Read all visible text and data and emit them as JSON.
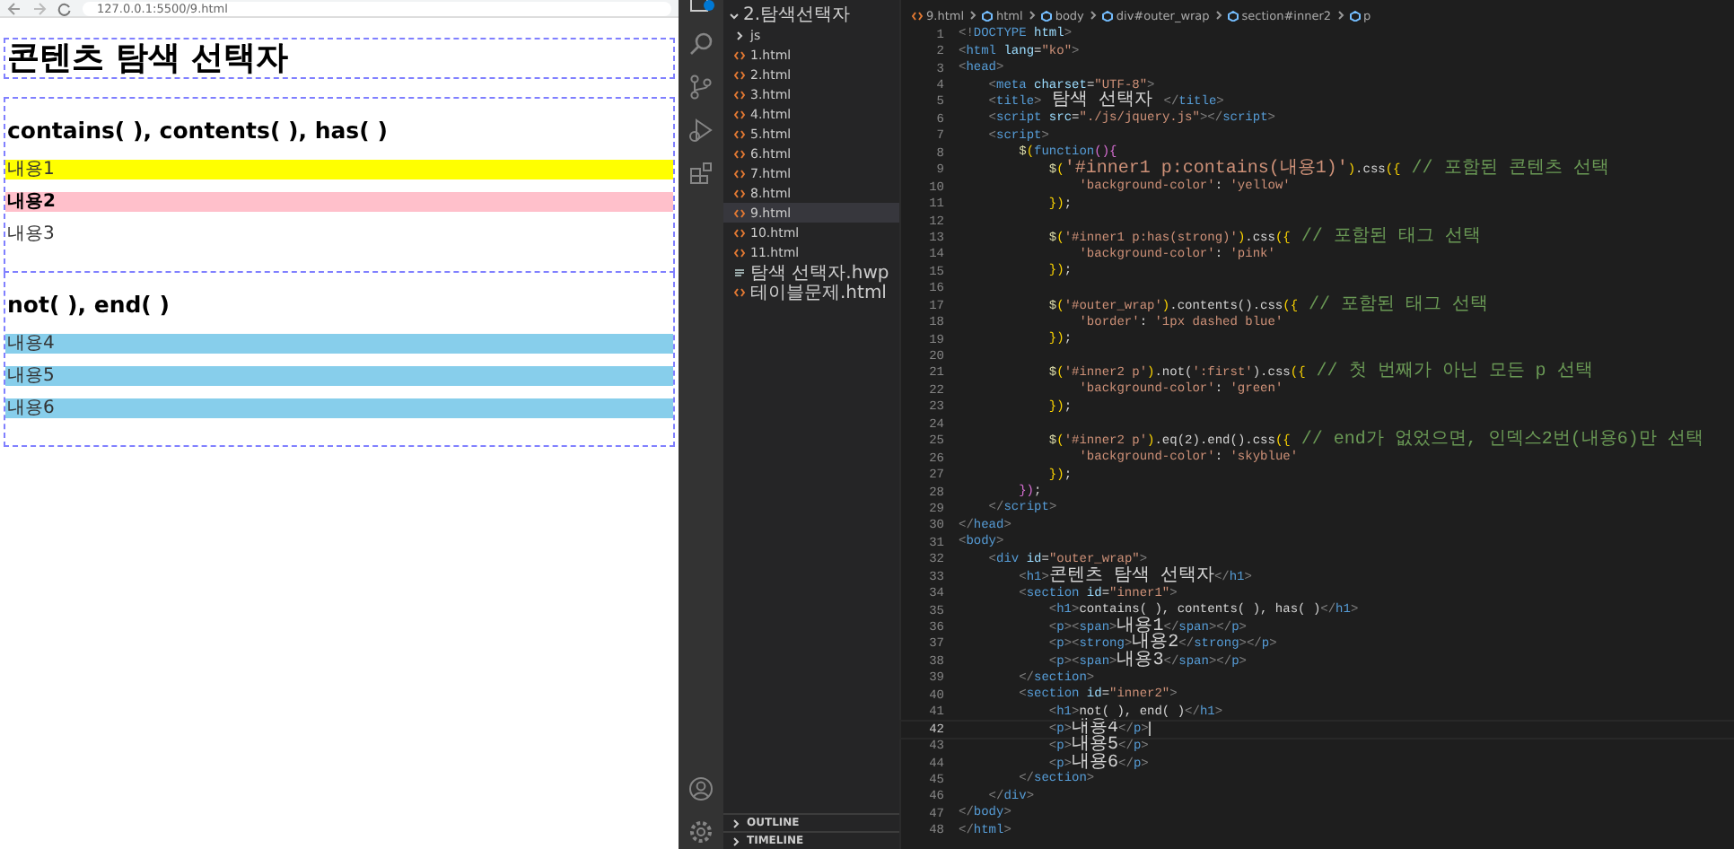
{
  "browser": {
    "url": "127.0.0.1:5500/9.html",
    "page": {
      "title": "콘텐츠 탐색 선택자",
      "sections": [
        {
          "heading": "contains( ), contents( ), has( )",
          "paragraphs": [
            {
              "text": "내용1",
              "color": "#ffff00",
              "bold": false
            },
            {
              "text": "내용2",
              "color": "#ffc0cb",
              "bold": true
            },
            {
              "text": "내용3",
              "bold": false
            }
          ]
        },
        {
          "heading": "not( ), end( )",
          "paragraphs": [
            {
              "text": "내용4",
              "color": "#87ceeb",
              "bold": false
            },
            {
              "text": "내용5",
              "color": "#87ceeb",
              "bold": false
            },
            {
              "text": "내용6",
              "color": "#87ceeb",
              "bold": false
            }
          ]
        }
      ]
    }
  },
  "explorer": {
    "folder": "2.탐색선택자",
    "expanded": true,
    "items": [
      {
        "kind": "folder",
        "name": "js",
        "selected": false
      },
      {
        "kind": "html",
        "name": "1.html",
        "selected": false
      },
      {
        "kind": "html",
        "name": "2.html",
        "selected": false
      },
      {
        "kind": "html",
        "name": "3.html",
        "selected": false
      },
      {
        "kind": "html",
        "name": "4.html",
        "selected": false
      },
      {
        "kind": "html",
        "name": "5.html",
        "selected": false
      },
      {
        "kind": "html",
        "name": "6.html",
        "selected": false
      },
      {
        "kind": "html",
        "name": "7.html",
        "selected": false
      },
      {
        "kind": "html",
        "name": "8.html",
        "selected": false
      },
      {
        "kind": "html",
        "name": "9.html",
        "selected": true
      },
      {
        "kind": "html",
        "name": "10.html",
        "selected": false
      },
      {
        "kind": "html",
        "name": "11.html",
        "selected": false
      },
      {
        "kind": "doc",
        "name": "탐색 선택자.hwp",
        "selected": false
      },
      {
        "kind": "html",
        "name": "테이블문제.html",
        "selected": false
      }
    ],
    "panels": [
      "OUTLINE",
      "TIMELINE"
    ]
  },
  "editor": {
    "breadcrumb": [
      "9.html",
      "html",
      "body",
      "div#outer_wrap",
      "section#inner2",
      "p"
    ],
    "lines": [
      {
        "num": "1",
        "current": false,
        "tokens": [
          {
            "kind": "punct",
            "text": "<!"
          },
          {
            "kind": "tag",
            "text": "DOCTYPE"
          },
          {
            "kind": "attr",
            "text": " html"
          },
          {
            "kind": "punct",
            "text": ">"
          }
        ]
      },
      {
        "num": "2",
        "current": false,
        "tokens": [
          {
            "kind": "punct",
            "text": "<"
          },
          {
            "kind": "tag",
            "text": "html"
          },
          {
            "kind": "attr",
            "text": " lang"
          },
          {
            "kind": "text",
            "text": "="
          },
          {
            "kind": "str",
            "text": "\"ko\""
          },
          {
            "kind": "punct",
            "text": ">"
          }
        ]
      },
      {
        "num": "3",
        "current": false,
        "tokens": [
          {
            "kind": "punct",
            "text": "<"
          },
          {
            "kind": "tag",
            "text": "head"
          },
          {
            "kind": "punct",
            "text": ">"
          }
        ]
      },
      {
        "num": "4",
        "current": false,
        "tokens": [
          {
            "kind": "punct",
            "text": "    <"
          },
          {
            "kind": "tag",
            "text": "meta"
          },
          {
            "kind": "attr",
            "text": " charset"
          },
          {
            "kind": "text",
            "text": "="
          },
          {
            "kind": "str",
            "text": "\"UTF-8\""
          },
          {
            "kind": "punct",
            "text": ">"
          }
        ]
      },
      {
        "num": "5",
        "current": false,
        "tokens": [
          {
            "kind": "punct",
            "text": "    <"
          },
          {
            "kind": "tag",
            "text": "title"
          },
          {
            "kind": "punct",
            "text": ">"
          },
          {
            "kind": "text",
            "text": " 탐색 선택자 "
          },
          {
            "kind": "punct",
            "text": "</"
          },
          {
            "kind": "tag",
            "text": "title"
          },
          {
            "kind": "punct",
            "text": ">"
          }
        ]
      },
      {
        "num": "6",
        "current": false,
        "tokens": [
          {
            "kind": "punct",
            "text": "    <"
          },
          {
            "kind": "tag",
            "text": "script"
          },
          {
            "kind": "attr",
            "text": " src"
          },
          {
            "kind": "text",
            "text": "="
          },
          {
            "kind": "str",
            "text": "\"./js/jquery.js\""
          },
          {
            "kind": "punct",
            "text": "></"
          },
          {
            "kind": "tag",
            "text": "script"
          },
          {
            "kind": "punct",
            "text": ">"
          }
        ]
      },
      {
        "num": "7",
        "current": false,
        "tokens": [
          {
            "kind": "punct",
            "text": "    <"
          },
          {
            "kind": "tag",
            "text": "script"
          },
          {
            "kind": "punct",
            "text": ">"
          }
        ]
      },
      {
        "num": "8",
        "current": false,
        "tokens": [
          {
            "kind": "fn",
            "text": "        $"
          },
          {
            "kind": "brace",
            "text": "("
          },
          {
            "kind": "tag",
            "text": "function"
          },
          {
            "kind": "brace2",
            "text": "(){"
          }
        ]
      },
      {
        "num": "9",
        "current": false,
        "tokens": [
          {
            "kind": "fn",
            "text": "            $"
          },
          {
            "kind": "brace",
            "text": "("
          },
          {
            "kind": "str",
            "text": "'#inner1 p:contains(내용1)'"
          },
          {
            "kind": "brace",
            "text": ")"
          },
          {
            "kind": "text",
            "text": ".css"
          },
          {
            "kind": "brace",
            "text": "({"
          },
          {
            "kind": "comment",
            "text": " // 포함된 콘텐츠 선택"
          }
        ]
      },
      {
        "num": "10",
        "current": false,
        "tokens": [
          {
            "kind": "str",
            "text": "                'background-color'"
          },
          {
            "kind": "text",
            "text": ": "
          },
          {
            "kind": "str",
            "text": "'yellow'"
          }
        ]
      },
      {
        "num": "11",
        "current": false,
        "tokens": [
          {
            "kind": "brace",
            "text": "            })"
          },
          {
            "kind": "text",
            "text": ";"
          }
        ]
      },
      {
        "num": "12",
        "current": false
      },
      {
        "num": "13",
        "current": false,
        "tokens": [
          {
            "kind": "fn",
            "text": "            $"
          },
          {
            "kind": "brace",
            "text": "("
          },
          {
            "kind": "str",
            "text": "'#inner1 p:has(strong)'"
          },
          {
            "kind": "brace",
            "text": ")"
          },
          {
            "kind": "text",
            "text": ".css"
          },
          {
            "kind": "brace",
            "text": "({"
          },
          {
            "kind": "comment",
            "text": " // 포함된 태그 선택"
          }
        ]
      },
      {
        "num": "14",
        "current": false,
        "tokens": [
          {
            "kind": "str",
            "text": "                'background-color'"
          },
          {
            "kind": "text",
            "text": ": "
          },
          {
            "kind": "str",
            "text": "'pink'"
          }
        ]
      },
      {
        "num": "15",
        "current": false,
        "tokens": [
          {
            "kind": "brace",
            "text": "            })"
          },
          {
            "kind": "text",
            "text": ";"
          }
        ]
      },
      {
        "num": "16",
        "current": false
      },
      {
        "num": "17",
        "current": false,
        "tokens": [
          {
            "kind": "fn",
            "text": "            $"
          },
          {
            "kind": "brace",
            "text": "("
          },
          {
            "kind": "str",
            "text": "'#outer_wrap'"
          },
          {
            "kind": "brace",
            "text": ")"
          },
          {
            "kind": "text",
            "text": ".contents().css"
          },
          {
            "kind": "brace",
            "text": "({"
          },
          {
            "kind": "comment",
            "text": " // 포함된 태그 선택"
          }
        ]
      },
      {
        "num": "18",
        "current": false,
        "tokens": [
          {
            "kind": "str",
            "text": "                'border'"
          },
          {
            "kind": "text",
            "text": ": "
          },
          {
            "kind": "str",
            "text": "'1px dashed blue'"
          }
        ]
      },
      {
        "num": "19",
        "current": false,
        "tokens": [
          {
            "kind": "brace",
            "text": "            })"
          },
          {
            "kind": "text",
            "text": ";"
          }
        ]
      },
      {
        "num": "20",
        "current": false
      },
      {
        "num": "21",
        "current": false,
        "tokens": [
          {
            "kind": "fn",
            "text": "            $"
          },
          {
            "kind": "brace",
            "text": "("
          },
          {
            "kind": "str",
            "text": "'#inner2 p'"
          },
          {
            "kind": "brace",
            "text": ")"
          },
          {
            "kind": "text",
            "text": ".not("
          },
          {
            "kind": "str",
            "text": "':first'"
          },
          {
            "kind": "text",
            "text": ").css"
          },
          {
            "kind": "brace",
            "text": "({"
          },
          {
            "kind": "comment",
            "text": " // 첫 번째가 아닌 모든 p 선택"
          }
        ]
      },
      {
        "num": "22",
        "current": false,
        "tokens": [
          {
            "kind": "str",
            "text": "                'background-color'"
          },
          {
            "kind": "text",
            "text": ": "
          },
          {
            "kind": "str",
            "text": "'green'"
          }
        ]
      },
      {
        "num": "23",
        "current": false,
        "tokens": [
          {
            "kind": "brace",
            "text": "            })"
          },
          {
            "kind": "text",
            "text": ";"
          }
        ]
      },
      {
        "num": "24",
        "current": false
      },
      {
        "num": "25",
        "current": false,
        "tokens": [
          {
            "kind": "fn",
            "text": "            $"
          },
          {
            "kind": "brace",
            "text": "("
          },
          {
            "kind": "str",
            "text": "'#inner2 p'"
          },
          {
            "kind": "brace",
            "text": ")"
          },
          {
            "kind": "text",
            "text": ".eq(2).end().css"
          },
          {
            "kind": "brace",
            "text": "({"
          },
          {
            "kind": "comment",
            "text": " // end가 없었으면, 인덱스2번(내용6)만 선택"
          }
        ]
      },
      {
        "num": "26",
        "current": false,
        "tokens": [
          {
            "kind": "str",
            "text": "                'background-color'"
          },
          {
            "kind": "text",
            "text": ": "
          },
          {
            "kind": "str",
            "text": "'skyblue'"
          }
        ]
      },
      {
        "num": "27",
        "current": false,
        "tokens": [
          {
            "kind": "brace",
            "text": "            })"
          },
          {
            "kind": "text",
            "text": ";"
          }
        ]
      },
      {
        "num": "28",
        "current": false,
        "tokens": [
          {
            "kind": "brace2",
            "text": "        })"
          },
          {
            "kind": "text",
            "text": ";"
          }
        ]
      },
      {
        "num": "29",
        "current": false,
        "tokens": [
          {
            "kind": "punct",
            "text": "    </"
          },
          {
            "kind": "tag",
            "text": "script"
          },
          {
            "kind": "punct",
            "text": ">"
          }
        ]
      },
      {
        "num": "30",
        "current": false,
        "tokens": [
          {
            "kind": "punct",
            "text": "</"
          },
          {
            "kind": "tag",
            "text": "head"
          },
          {
            "kind": "punct",
            "text": ">"
          }
        ]
      },
      {
        "num": "31",
        "current": false,
        "tokens": [
          {
            "kind": "punct",
            "text": "<"
          },
          {
            "kind": "tag",
            "text": "body"
          },
          {
            "kind": "punct",
            "text": ">"
          }
        ]
      },
      {
        "num": "32",
        "current": false,
        "tokens": [
          {
            "kind": "punct",
            "text": "    <"
          },
          {
            "kind": "tag",
            "text": "div"
          },
          {
            "kind": "attr",
            "text": " id"
          },
          {
            "kind": "text",
            "text": "="
          },
          {
            "kind": "str",
            "text": "\"outer_wrap\""
          },
          {
            "kind": "punct",
            "text": ">"
          }
        ]
      },
      {
        "num": "33",
        "current": false,
        "tokens": [
          {
            "kind": "punct",
            "text": "        <"
          },
          {
            "kind": "tag",
            "text": "h1"
          },
          {
            "kind": "punct",
            "text": ">"
          },
          {
            "kind": "text",
            "text": "콘텐츠 탐색 선택자"
          },
          {
            "kind": "punct",
            "text": "</"
          },
          {
            "kind": "tag",
            "text": "h1"
          },
          {
            "kind": "punct",
            "text": ">"
          }
        ]
      },
      {
        "num": "34",
        "current": false,
        "tokens": [
          {
            "kind": "punct",
            "text": "        <"
          },
          {
            "kind": "tag",
            "text": "section"
          },
          {
            "kind": "attr",
            "text": " id"
          },
          {
            "kind": "text",
            "text": "="
          },
          {
            "kind": "str",
            "text": "\"inner1\""
          },
          {
            "kind": "punct",
            "text": ">"
          }
        ]
      },
      {
        "num": "35",
        "current": false,
        "tokens": [
          {
            "kind": "punct",
            "text": "            <"
          },
          {
            "kind": "tag",
            "text": "h1"
          },
          {
            "kind": "punct",
            "text": ">"
          },
          {
            "kind": "text",
            "text": "contains( ), contents( ), has( )"
          },
          {
            "kind": "punct",
            "text": "</"
          },
          {
            "kind": "tag",
            "text": "h1"
          },
          {
            "kind": "punct",
            "text": ">"
          }
        ]
      },
      {
        "num": "36",
        "current": false,
        "tokens": [
          {
            "kind": "punct",
            "text": "            <"
          },
          {
            "kind": "tag",
            "text": "p"
          },
          {
            "kind": "punct",
            "text": "><"
          },
          {
            "kind": "tag",
            "text": "span"
          },
          {
            "kind": "punct",
            "text": ">"
          },
          {
            "kind": "text",
            "text": "내용1"
          },
          {
            "kind": "punct",
            "text": "</"
          },
          {
            "kind": "tag",
            "text": "span"
          },
          {
            "kind": "punct",
            "text": "></"
          },
          {
            "kind": "tag",
            "text": "p"
          },
          {
            "kind": "punct",
            "text": ">"
          }
        ]
      },
      {
        "num": "37",
        "current": false,
        "tokens": [
          {
            "kind": "punct",
            "text": "            <"
          },
          {
            "kind": "tag",
            "text": "p"
          },
          {
            "kind": "punct",
            "text": "><"
          },
          {
            "kind": "tag",
            "text": "strong"
          },
          {
            "kind": "punct",
            "text": ">"
          },
          {
            "kind": "text",
            "text": "내용2"
          },
          {
            "kind": "punct",
            "text": "</"
          },
          {
            "kind": "tag",
            "text": "strong"
          },
          {
            "kind": "punct",
            "text": "></"
          },
          {
            "kind": "tag",
            "text": "p"
          },
          {
            "kind": "punct",
            "text": ">"
          }
        ]
      },
      {
        "num": "38",
        "current": false,
        "tokens": [
          {
            "kind": "punct",
            "text": "            <"
          },
          {
            "kind": "tag",
            "text": "p"
          },
          {
            "kind": "punct",
            "text": "><"
          },
          {
            "kind": "tag",
            "text": "span"
          },
          {
            "kind": "punct",
            "text": ">"
          },
          {
            "kind": "text",
            "text": "내용3"
          },
          {
            "kind": "punct",
            "text": "</"
          },
          {
            "kind": "tag",
            "text": "span"
          },
          {
            "kind": "punct",
            "text": "></"
          },
          {
            "kind": "tag",
            "text": "p"
          },
          {
            "kind": "punct",
            "text": ">"
          }
        ]
      },
      {
        "num": "39",
        "current": false,
        "tokens": [
          {
            "kind": "punct",
            "text": "        </"
          },
          {
            "kind": "tag",
            "text": "section"
          },
          {
            "kind": "punct",
            "text": ">"
          }
        ]
      },
      {
        "num": "40",
        "current": false,
        "tokens": [
          {
            "kind": "punct",
            "text": "        <"
          },
          {
            "kind": "tag",
            "text": "section"
          },
          {
            "kind": "attr",
            "text": " id"
          },
          {
            "kind": "text",
            "text": "="
          },
          {
            "kind": "str",
            "text": "\"inner2\""
          },
          {
            "kind": "punct",
            "text": ">"
          }
        ]
      },
      {
        "num": "41",
        "current": false,
        "tokens": [
          {
            "kind": "punct",
            "text": "            <"
          },
          {
            "kind": "tag",
            "text": "h1"
          },
          {
            "kind": "punct",
            "text": ">"
          },
          {
            "kind": "text",
            "text": "not( ), end( )"
          },
          {
            "kind": "punct",
            "text": "</"
          },
          {
            "kind": "tag",
            "text": "h1"
          },
          {
            "kind": "punct",
            "text": ">"
          }
        ]
      },
      {
        "num": "42",
        "current": true,
        "tokens": [
          {
            "kind": "punct",
            "text": "            <"
          },
          {
            "kind": "tag",
            "text": "p"
          },
          {
            "kind": "punct",
            "text": ">"
          },
          {
            "kind": "text",
            "text": "내용4"
          },
          {
            "kind": "punct",
            "text": "</"
          },
          {
            "kind": "tag",
            "text": "p"
          },
          {
            "kind": "punct",
            "text": ">"
          }
        ]
      },
      {
        "num": "43",
        "current": false,
        "tokens": [
          {
            "kind": "punct",
            "text": "            <"
          },
          {
            "kind": "tag",
            "text": "p"
          },
          {
            "kind": "punct",
            "text": ">"
          },
          {
            "kind": "text",
            "text": "내용5"
          },
          {
            "kind": "punct",
            "text": "</"
          },
          {
            "kind": "tag",
            "text": "p"
          },
          {
            "kind": "punct",
            "text": ">"
          }
        ]
      },
      {
        "num": "44",
        "current": false,
        "tokens": [
          {
            "kind": "punct",
            "text": "            <"
          },
          {
            "kind": "tag",
            "text": "p"
          },
          {
            "kind": "punct",
            "text": ">"
          },
          {
            "kind": "text",
            "text": "내용6"
          },
          {
            "kind": "punct",
            "text": "</"
          },
          {
            "kind": "tag",
            "text": "p"
          },
          {
            "kind": "punct",
            "text": ">"
          }
        ]
      },
      {
        "num": "45",
        "current": false,
        "tokens": [
          {
            "kind": "punct",
            "text": "        </"
          },
          {
            "kind": "tag",
            "text": "section"
          },
          {
            "kind": "punct",
            "text": ">"
          }
        ]
      },
      {
        "num": "46",
        "current": false,
        "tokens": [
          {
            "kind": "punct",
            "text": "    </"
          },
          {
            "kind": "tag",
            "text": "div"
          },
          {
            "kind": "punct",
            "text": ">"
          }
        ]
      },
      {
        "num": "47",
        "current": false,
        "tokens": [
          {
            "kind": "punct",
            "text": "</"
          },
          {
            "kind": "tag",
            "text": "body"
          },
          {
            "kind": "punct",
            "text": ">"
          }
        ]
      },
      {
        "num": "48",
        "current": false,
        "tokens": [
          {
            "kind": "punct",
            "text": "</"
          },
          {
            "kind": "tag",
            "text": "html"
          },
          {
            "kind": "punct",
            "text": ">"
          }
        ]
      }
    ]
  }
}
